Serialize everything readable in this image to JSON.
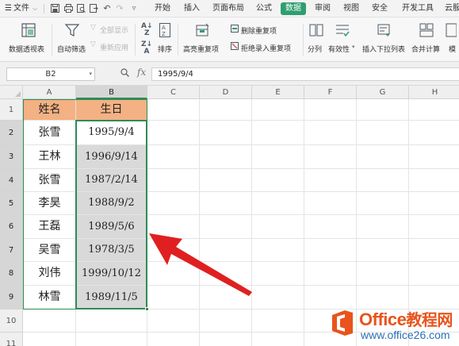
{
  "menu": {
    "file_label": "文件",
    "tabs": [
      "开始",
      "插入",
      "页面布局",
      "公式",
      "数据",
      "审阅",
      "视图",
      "安全",
      "开发工具",
      "云服"
    ],
    "active_tab": "数据"
  },
  "ribbon": {
    "pivot": "数据透视表",
    "autofilter": "自动筛选",
    "show_all": "全部显示",
    "reapply": "重新应用",
    "sort": "排序",
    "highlight_dup": "高亮重复项",
    "remove_dup": "删除重复项",
    "reject_dup": "拒绝录入重复项",
    "split": "分列",
    "validity": "有效性",
    "insert_dropdown": "插入下拉列表",
    "consolidate": "合并计算",
    "simulate": "模"
  },
  "formula_bar": {
    "name_box": "B2",
    "fx": "fx",
    "value": "1995/9/4"
  },
  "grid": {
    "columns": [
      "A",
      "B",
      "C",
      "D",
      "E",
      "F",
      "G",
      "H"
    ],
    "rows": [
      "1",
      "2",
      "3",
      "4",
      "5",
      "6",
      "7",
      "8",
      "9",
      "10",
      "11"
    ],
    "header": {
      "name": "姓名",
      "birthday": "生日"
    },
    "records": [
      {
        "name": "张雪",
        "birthday": "1995/9/4"
      },
      {
        "name": "王林",
        "birthday": "1996/9/14"
      },
      {
        "name": "张雪",
        "birthday": "1987/2/14"
      },
      {
        "name": "李昊",
        "birthday": "1988/9/2"
      },
      {
        "name": "王磊",
        "birthday": "1989/5/6"
      },
      {
        "name": "吴雪",
        "birthday": "1978/3/5"
      },
      {
        "name": "刘伟",
        "birthday": "1999/10/12"
      },
      {
        "name": "林雪",
        "birthday": "1989/11/5"
      }
    ],
    "selected_column": "B",
    "active_cell": "B2"
  },
  "colors": {
    "header_fill": "#f4b183",
    "selection_border": "#2e8b57",
    "selection_fill": "#d9d9d9",
    "arrow": "#e02020",
    "active_tab": "#2f9e6f"
  },
  "watermark": {
    "brand": "Office",
    "brand_cn": "教程网",
    "url": "www.office26.com"
  }
}
